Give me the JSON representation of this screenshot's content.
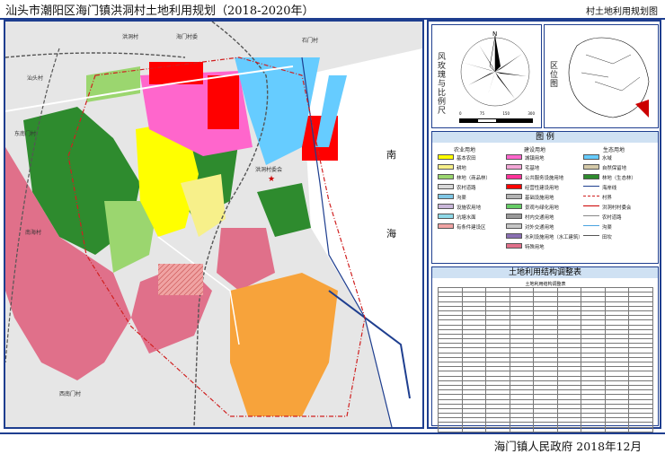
{
  "header": {
    "title": "汕头市潮阳区海门镇洪洞村土地利用规划（2018-2020年）",
    "subtitle": "村土地利用规划图"
  },
  "compass": {
    "label": "风玫瑰与比例尺",
    "north": "N",
    "scale_ticks": [
      "0",
      "75",
      "150",
      "300"
    ]
  },
  "location": {
    "label": "区位图"
  },
  "sea_labels": {
    "south": "南",
    "sea": "海"
  },
  "legend": {
    "title": "图 例",
    "groups": {
      "agri": "农业用地",
      "build": "建设用地",
      "eco": "生态用地"
    },
    "agri_items": [
      {
        "label": "基本农田",
        "color": "#ffff00"
      },
      {
        "label": "耕地",
        "color": "#f7f08a"
      },
      {
        "label": "林地（商品林）",
        "color": "#9bd66f"
      },
      {
        "label": "农村道路",
        "color": "#d9d9d9"
      },
      {
        "label": "沟渠",
        "color": "#7fc7e5"
      },
      {
        "label": "设施农用地",
        "color": "#c9b7d9"
      },
      {
        "label": "坑塘水面",
        "color": "#8fd9e8"
      },
      {
        "label": "有条件建设区",
        "color": "#f0a3a3"
      }
    ],
    "build_items": [
      {
        "label": "城镇用地",
        "color": "#ff66cc"
      },
      {
        "label": "宅基地",
        "color": "#f3a6d6"
      },
      {
        "label": "公共服务设施用地",
        "color": "#ff3399"
      },
      {
        "label": "经营性建设用地",
        "color": "#ff0000"
      },
      {
        "label": "基础设施用地",
        "color": "#b3b3b3"
      },
      {
        "label": "景观与绿化用地",
        "color": "#66cc66"
      },
      {
        "label": "村内交通用地",
        "color": "#999999"
      },
      {
        "label": "对外交通用地",
        "color": "#c6c6c6"
      },
      {
        "label": "水利设施用地（水工建筑）",
        "color": "#8a6fb3"
      },
      {
        "label": "特殊用地",
        "color": "#e0708a"
      }
    ],
    "eco_items": [
      {
        "label": "水域",
        "color": "#66ccff"
      },
      {
        "label": "自然保留地",
        "color": "#d4c9a8"
      },
      {
        "label": "林地（生态林）",
        "color": "#2e8b2e"
      }
    ],
    "line_items": [
      {
        "label": "海岸线"
      },
      {
        "label": "村界"
      },
      {
        "label": "洪洞村村委会"
      },
      {
        "label": "农村道路"
      },
      {
        "label": "沟渠"
      },
      {
        "label": "田坎"
      }
    ]
  },
  "table": {
    "title": "土地利用结构调整表",
    "subtitle": "土地利用结构调整表"
  },
  "map_labels": [
    {
      "text": "洪洞村"
    },
    {
      "text": "石门村"
    },
    {
      "text": "汕头村"
    },
    {
      "text": "西南门村"
    },
    {
      "text": "东南门村"
    },
    {
      "text": "海门村委"
    },
    {
      "text": "南海村"
    },
    {
      "text": "洪洞村委会"
    }
  ],
  "footer": {
    "text": "海门镇人民政府  2018年12月"
  }
}
